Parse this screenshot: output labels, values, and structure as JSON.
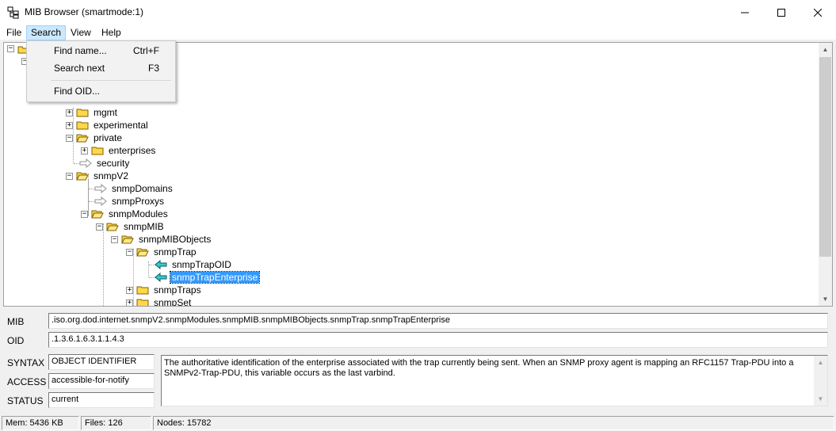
{
  "window": {
    "title": "MIB Browser (smartmode:1)",
    "minimize_icon": "minimize-icon",
    "maximize_icon": "maximize-icon",
    "close_icon": "close-icon"
  },
  "menu": {
    "file": "File",
    "search": "Search",
    "view": "View",
    "help": "Help"
  },
  "search_menu": {
    "find_name": "Find name...",
    "find_name_shortcut": "Ctrl+F",
    "search_next": "Search next",
    "search_next_shortcut": "F3",
    "find_oid": "Find OID..."
  },
  "tree": {
    "mgmt": "mgmt",
    "experimental": "experimental",
    "private": "private",
    "enterprises": "enterprises",
    "security": "security",
    "snmpV2": "snmpV2",
    "snmpDomains": "snmpDomains",
    "snmpProxys": "snmpProxys",
    "snmpModules": "snmpModules",
    "snmpMIB": "snmpMIB",
    "snmpMIBObjects": "snmpMIBObjects",
    "snmpTrap": "snmpTrap",
    "snmpTrapOID": "snmpTrapOID",
    "snmpTrapEnterprise": "snmpTrapEnterprise",
    "snmpTraps": "snmpTraps",
    "snmpSet": "snmpSet"
  },
  "details": {
    "mib_label": "MIB",
    "mib_value": ".iso.org.dod.internet.snmpV2.snmpModules.snmpMIB.snmpMIBObjects.snmpTrap.snmpTrapEnterprise",
    "oid_label": "OID",
    "oid_value": ".1.3.6.1.6.3.1.1.4.3",
    "syntax_label": "SYNTAX",
    "syntax_value": "OBJECT IDENTIFIER",
    "access_label": "ACCESS",
    "access_value": "accessible-for-notify",
    "status_label": "STATUS",
    "status_value": "current",
    "description": "The authoritative identification of the enterprise associated with the trap currently being sent.  When an SNMP proxy agent is mapping an RFC1157 Trap-PDU into a SNMPv2-Trap-PDU, this variable occurs as the last varbind."
  },
  "status": {
    "mem": "Mem: 5436 KB",
    "files": "Files: 126",
    "nodes": "Nodes: 15782"
  },
  "colors": {
    "selection": "#3399ff",
    "menu_highlight": "#cce8ff",
    "folder": "#ffd84a",
    "leaf_arrow": "#3cc8c8"
  }
}
